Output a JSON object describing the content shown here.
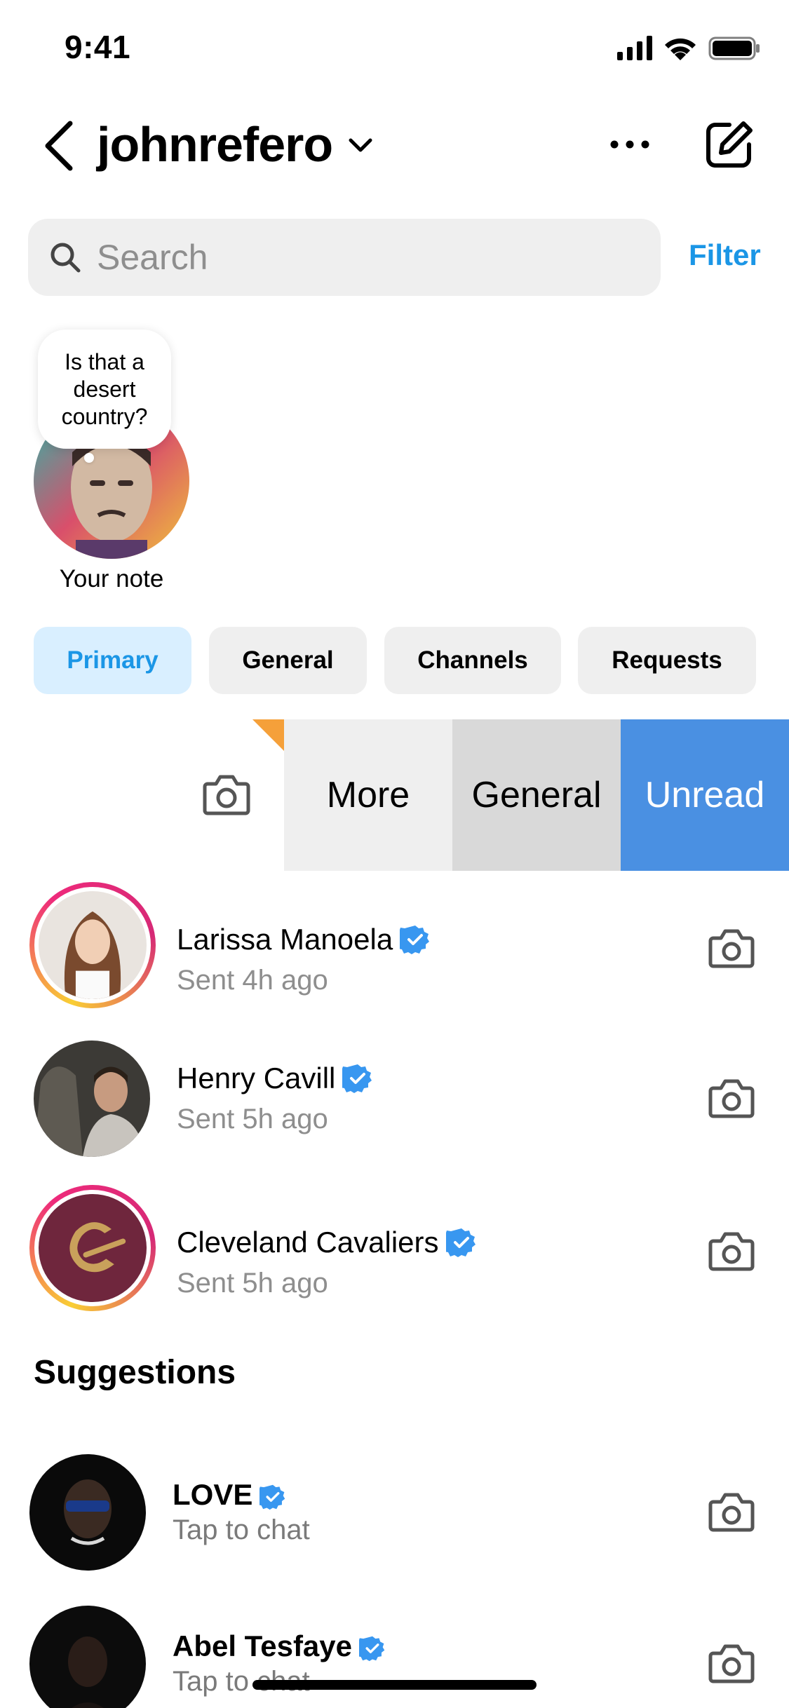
{
  "status_bar": {
    "time": "9:41"
  },
  "header": {
    "username": "johnrefero"
  },
  "search": {
    "placeholder": "Search",
    "filter_label": "Filter"
  },
  "note": {
    "text": "Is that a desert country?",
    "label": "Your note"
  },
  "tabs": [
    {
      "label": "Primary",
      "active": true
    },
    {
      "label": "General",
      "active": false
    },
    {
      "label": "Channels",
      "active": false
    },
    {
      "label": "Requests",
      "active": false
    }
  ],
  "swipe_actions": {
    "more": "More",
    "general": "General",
    "unread": "Unread"
  },
  "messages": [
    {
      "name": "Larissa Manoela",
      "verified": true,
      "subtitle": "Sent 4h ago",
      "story_ring": true
    },
    {
      "name": "Henry Cavill",
      "verified": true,
      "subtitle": "Sent 5h ago",
      "story_ring": false
    },
    {
      "name": "Cleveland Cavaliers",
      "verified": true,
      "subtitle": "Sent 5h ago",
      "story_ring": true
    }
  ],
  "suggestions": {
    "title": "Suggestions",
    "items": [
      {
        "name": "LOVE",
        "verified": true,
        "subtitle": "Tap to chat"
      },
      {
        "name": "Abel Tesfaye",
        "verified": true,
        "subtitle": "Tap to chat"
      }
    ]
  },
  "colors": {
    "accent": "#1b96e6",
    "unread": "#4a90e2",
    "verified": "#3897f0"
  }
}
